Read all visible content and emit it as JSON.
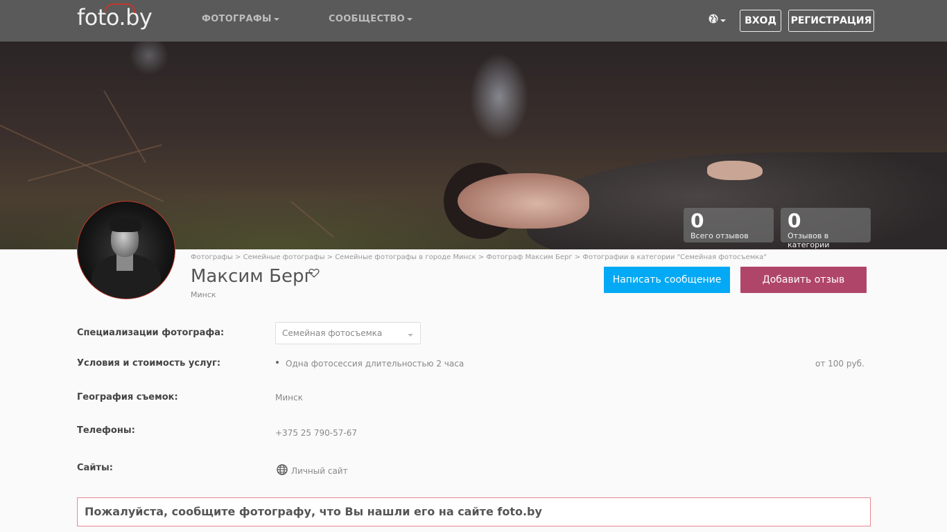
{
  "header": {
    "logo": "foto.by",
    "nav": [
      {
        "label": "ФОТОГРАФЫ"
      },
      {
        "label": "СООБЩЕСТВО"
      }
    ],
    "login": "ВХОД",
    "register": "РЕГИСТРАЦИЯ"
  },
  "stats": [
    {
      "value": "0",
      "label": "Всего отзывов"
    },
    {
      "value": "0",
      "label": "Отзывов в категории"
    }
  ],
  "breadcrumb": "Фотографы > Семейные фотографы > Семейные фотографы в городе Минск > Фотограф Максим Берг > Фотографии в категории \"Семейная фотосъемка\"",
  "profile": {
    "name": "Максим Берг",
    "city": "Минск"
  },
  "actions": {
    "message": "Написать сообщение",
    "review": "Добавить отзыв"
  },
  "details": {
    "specializations_label": "Специализации фотографа:",
    "specializations_value": "Семейная фотосъемка",
    "terms_label": "Условия и стоимость услуг:",
    "terms_item": "Одна фотосессия длительностью 2 часа",
    "terms_price": "от 100 руб.",
    "geo_label": "География съемок:",
    "geo_value": "Минск",
    "phones_label": "Телефоны:",
    "phones_value": "+375 25 790-57-67",
    "sites_label": "Сайты:",
    "sites_value": "Личный сайт"
  },
  "notice": "Пожалуйста, сообщите фотографу, что Вы нашли его на сайте foto.by",
  "colors": {
    "header_bg": "#5a5a5a",
    "message_btn": "#03a9f4",
    "review_btn": "#b0456a",
    "notice_border": "#e8868c"
  }
}
